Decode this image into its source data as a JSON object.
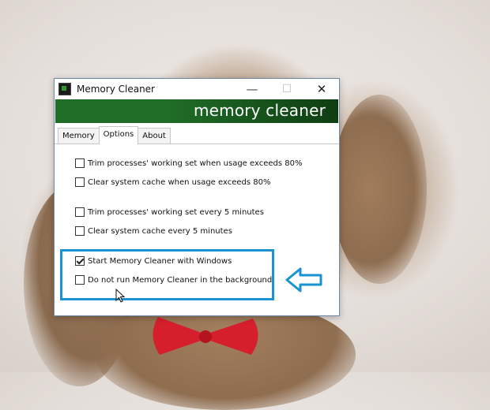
{
  "window": {
    "title": "Memory Cleaner",
    "controls": {
      "minimize": "—",
      "maximize": "☐",
      "close": "✕"
    },
    "banner": "memory cleaner",
    "tabs": [
      "Memory",
      "Options",
      "About"
    ],
    "active_tab": "Options"
  },
  "options": [
    {
      "label": "Trim processes' working set when usage exceeds 80%",
      "checked": false
    },
    {
      "label": "Clear system cache when usage exceeds 80%",
      "checked": false
    },
    {
      "label": "Trim processes' working set every 5 minutes",
      "checked": false
    },
    {
      "label": "Clear system cache every 5 minutes",
      "checked": false
    },
    {
      "label": "Start Memory Cleaner with Windows",
      "checked": true
    },
    {
      "label": "Do not run Memory Cleaner in the background",
      "checked": false
    }
  ],
  "colors": {
    "banner_green": "#1f6d27",
    "highlight_blue": "#1a93d1"
  },
  "icons": [
    "app-icon",
    "arrow-left-outline-icon",
    "mouse-cursor-icon"
  ]
}
